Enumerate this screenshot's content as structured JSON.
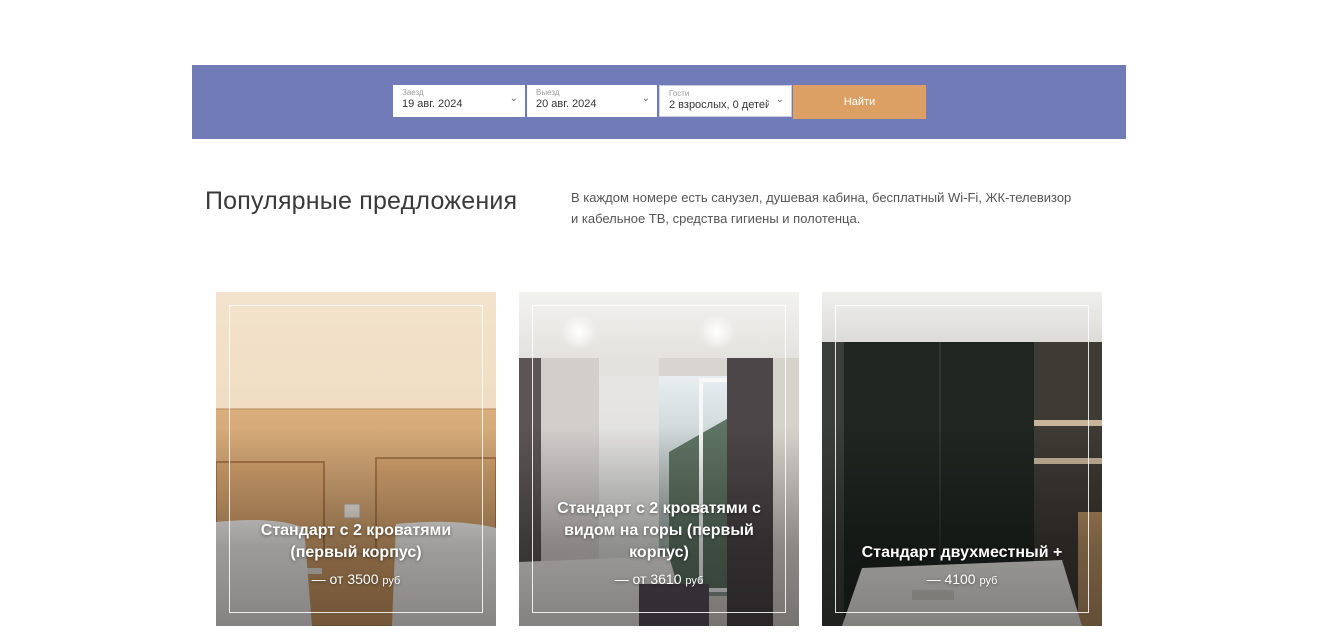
{
  "booking": {
    "checkin": {
      "label": "Заезд",
      "value": "19 авг. 2024"
    },
    "checkout": {
      "label": "Выезд",
      "value": "20 авг. 2024"
    },
    "guests": {
      "label": "Гости",
      "value": "2 взрослых, 0 детей"
    },
    "search_label": "Найти"
  },
  "section": {
    "title": "Популярные предложения",
    "description": "В каждом номере есть санузел, душевая кабина, бесплатный Wi-Fi, ЖК-телевизор и кабельное ТВ, средства гигиены и полотенца."
  },
  "rooms": [
    {
      "name": "Стандарт с 2 кроватями (первый корпус)",
      "price_prefix": "— от ",
      "price": "3500",
      "currency": "руб"
    },
    {
      "name": "Стандарт с 2 кроватями с видом на горы (первый корпус)",
      "price_prefix": "— от ",
      "price": "3610",
      "currency": "руб"
    },
    {
      "name": "Стандарт двухместный +",
      "price_prefix": "— ",
      "price": "4100",
      "currency": "руб"
    }
  ],
  "colors": {
    "booking_bar": "#717bb8",
    "search_button": "#dca065"
  },
  "icons": {
    "dropdown": "chevron-down-icon"
  }
}
